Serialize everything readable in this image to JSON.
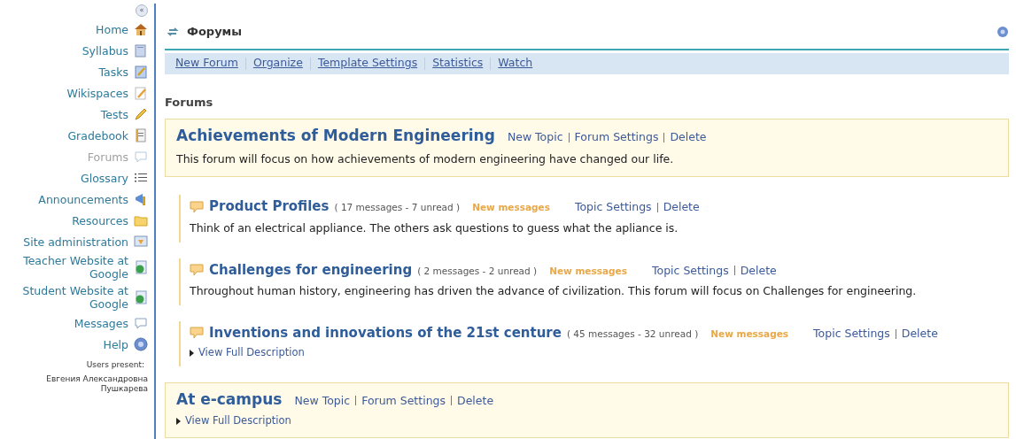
{
  "sidebar": {
    "collapse_label": "«",
    "items": [
      {
        "label": "Home",
        "selected": false
      },
      {
        "label": "Syllabus",
        "selected": false
      },
      {
        "label": "Tasks",
        "selected": false
      },
      {
        "label": "Wikispaces",
        "selected": false
      },
      {
        "label": "Tests",
        "selected": false
      },
      {
        "label": "Gradebook",
        "selected": false
      },
      {
        "label": "Forums",
        "selected": true
      },
      {
        "label": "Glossary",
        "selected": false
      },
      {
        "label": "Announcements",
        "selected": false
      },
      {
        "label": "Resources",
        "selected": false
      },
      {
        "label": "Site administration",
        "selected": false
      },
      {
        "label": "Teacher Website at Google",
        "selected": false
      },
      {
        "label": "Student Website at Google",
        "selected": false
      },
      {
        "label": "Messages",
        "selected": false
      },
      {
        "label": "Help",
        "selected": false
      }
    ],
    "users_present_label": "Users present:",
    "users": [
      "Евгения Александровна Пушкарева"
    ]
  },
  "header": {
    "title": "Форумы"
  },
  "toolbar": [
    "New Forum",
    "Organize",
    "Template Settings",
    "Statistics",
    "Watch"
  ],
  "section_title": "Forums",
  "forums": [
    {
      "title": "Achievements of Modern Engineering",
      "actions": [
        "New Topic",
        "Forum Settings",
        "Delete"
      ],
      "description": "This forum will focus on how achievements of modern engineering have changed our life.",
      "topics": [
        {
          "title": "Product Profiles",
          "meta": "( 17 messages - 7 unread )",
          "new_messages": "New messages",
          "actions": [
            "Topic Settings",
            "Delete"
          ],
          "description": "Think of an electrical appliance. The others ask questions to guess what the apliance is."
        },
        {
          "title": "Challenges for engineering",
          "meta": "( 2 messages - 2 unread )",
          "new_messages": "New messages",
          "actions": [
            "Topic Settings",
            "Delete"
          ],
          "description": "Throughout human history, engineering has driven the advance of civilization. This forum will focus on Challenges for engineering."
        },
        {
          "title": "Inventions and innovations of the 21st centure",
          "meta": "( 45 messages - 32 unread )",
          "new_messages": "New messages",
          "actions": [
            "Topic Settings",
            "Delete"
          ],
          "expander": "View Full Description"
        }
      ]
    },
    {
      "title": "At e-campus",
      "actions": [
        "New Topic",
        "Forum Settings",
        "Delete"
      ],
      "expander": "View Full Description"
    }
  ]
}
